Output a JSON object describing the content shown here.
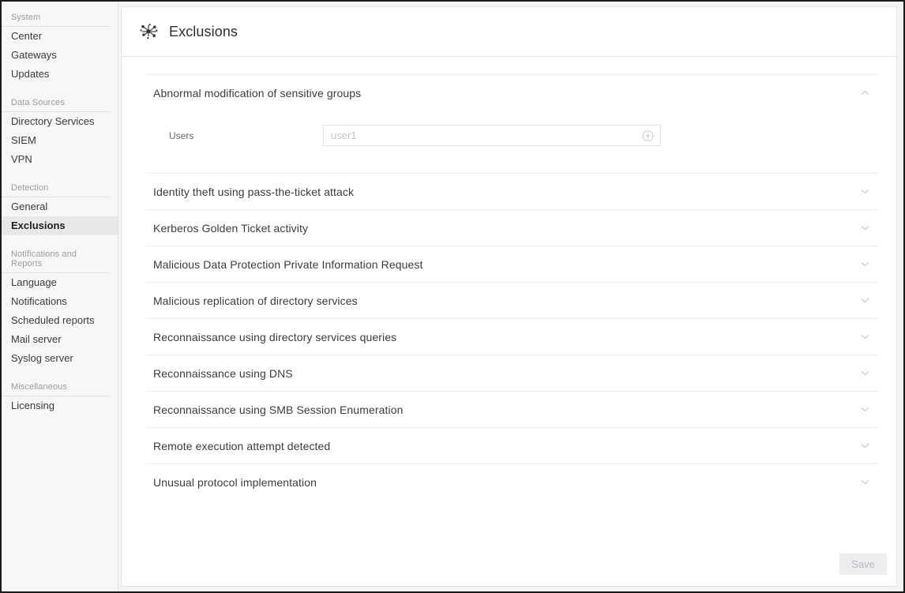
{
  "sidebar": {
    "groups": [
      {
        "title": "System",
        "items": [
          {
            "label": "Center",
            "selected": false
          },
          {
            "label": "Gateways",
            "selected": false
          },
          {
            "label": "Updates",
            "selected": false
          }
        ]
      },
      {
        "title": "Data Sources",
        "items": [
          {
            "label": "Directory Services",
            "selected": false
          },
          {
            "label": "SIEM",
            "selected": false
          },
          {
            "label": "VPN",
            "selected": false
          }
        ]
      },
      {
        "title": "Detection",
        "items": [
          {
            "label": "General",
            "selected": false
          },
          {
            "label": "Exclusions",
            "selected": true
          }
        ]
      },
      {
        "title": "Notifications and Reports",
        "items": [
          {
            "label": "Language",
            "selected": false
          },
          {
            "label": "Notifications",
            "selected": false
          },
          {
            "label": "Scheduled reports",
            "selected": false
          },
          {
            "label": "Mail server",
            "selected": false
          },
          {
            "label": "Syslog server",
            "selected": false
          }
        ]
      },
      {
        "title": "Miscellaneous",
        "items": [
          {
            "label": "Licensing",
            "selected": false
          }
        ]
      }
    ]
  },
  "header": {
    "icon": "network-nodes-icon",
    "title": "Exclusions"
  },
  "main": {
    "sections": [
      {
        "title": "Abnormal modification of sensitive groups",
        "expanded": true,
        "chevron": "chevron-up-icon",
        "field": {
          "label": "Users",
          "value": "",
          "placeholder": "user1",
          "add_icon": "circle-plus-icon"
        }
      },
      {
        "title": "Identity theft using pass-the-ticket attack",
        "expanded": false,
        "chevron": "chevron-down-icon"
      },
      {
        "title": "Kerberos Golden Ticket activity",
        "expanded": false,
        "chevron": "chevron-down-icon"
      },
      {
        "title": "Malicious Data Protection Private Information Request",
        "expanded": false,
        "chevron": "chevron-down-icon"
      },
      {
        "title": "Malicious replication of directory services",
        "expanded": false,
        "chevron": "chevron-down-icon"
      },
      {
        "title": "Reconnaissance using directory services queries",
        "expanded": false,
        "chevron": "chevron-down-icon"
      },
      {
        "title": "Reconnaissance using DNS",
        "expanded": false,
        "chevron": "chevron-down-icon"
      },
      {
        "title": "Reconnaissance using SMB Session Enumeration",
        "expanded": false,
        "chevron": "chevron-down-icon"
      },
      {
        "title": "Remote execution attempt detected",
        "expanded": false,
        "chevron": "chevron-down-icon"
      },
      {
        "title": "Unusual protocol implementation",
        "expanded": false,
        "chevron": "chevron-down-icon"
      }
    ]
  },
  "footer": {
    "save_label": "Save",
    "save_disabled": true
  },
  "colors": {
    "sidebar_bg": "#f7f7f8",
    "selected_bg": "#e8e8ea",
    "card_bg": "#ffffff",
    "border": "#e6e6e8",
    "text": "#3c3c3e",
    "muted": "#9b9b9e",
    "disabled_btn_bg": "#ededef",
    "disabled_btn_text": "#b9b9bd"
  }
}
